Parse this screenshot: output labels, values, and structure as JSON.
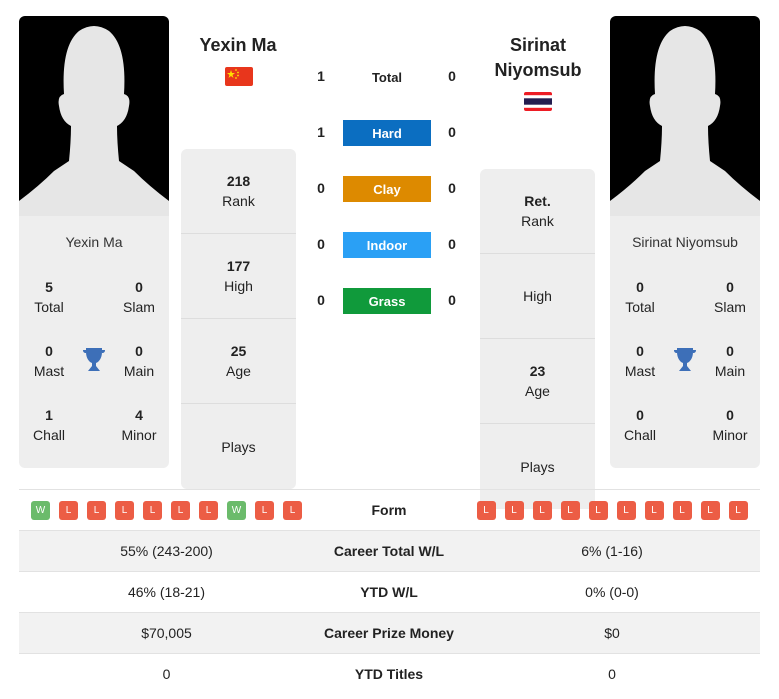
{
  "colors": {
    "hard": "#0b6ec1",
    "clay": "#dd8a00",
    "indoor": "#2aa0f5",
    "grass": "#109a3b",
    "win": "#6bbb6b",
    "loss": "#ec5d45",
    "trophy": "#3d6fb8"
  },
  "player1": {
    "name": "Yexin Ma",
    "flag": "china-flag",
    "card_name": "Yexin Ma",
    "titles": {
      "total": "5",
      "total_label": "Total",
      "slam": "0",
      "slam_label": "Slam",
      "mast": "0",
      "mast_label": "Mast",
      "main": "0",
      "main_label": "Main",
      "chall": "1",
      "chall_label": "Chall",
      "minor": "4",
      "minor_label": "Minor"
    },
    "rank": "218",
    "rank_label": "Rank",
    "high": "177",
    "high_label": "High",
    "age": "25",
    "age_label": "Age",
    "plays": "",
    "plays_label": "Plays",
    "form": [
      "W",
      "L",
      "L",
      "L",
      "L",
      "L",
      "L",
      "W",
      "L",
      "L"
    ]
  },
  "player2": {
    "name": "Sirinat Niyomsub",
    "flag": "thailand-flag",
    "card_name": "Sirinat Niyomsub",
    "titles": {
      "total": "0",
      "total_label": "Total",
      "slam": "0",
      "slam_label": "Slam",
      "mast": "0",
      "mast_label": "Mast",
      "main": "0",
      "main_label": "Main",
      "chall": "0",
      "chall_label": "Chall",
      "minor": "0",
      "minor_label": "Minor"
    },
    "rank": "Ret.",
    "rank_label": "Rank",
    "high": "",
    "high_label": "High",
    "age": "23",
    "age_label": "Age",
    "plays": "",
    "plays_label": "Plays",
    "form": [
      "L",
      "L",
      "L",
      "L",
      "L",
      "L",
      "L",
      "L",
      "L",
      "L"
    ]
  },
  "h2h": [
    {
      "label": "Total",
      "p1": "1",
      "p2": "0"
    },
    {
      "label": "Hard",
      "p1": "1",
      "p2": "0"
    },
    {
      "label": "Clay",
      "p1": "0",
      "p2": "0"
    },
    {
      "label": "Indoor",
      "p1": "0",
      "p2": "0"
    },
    {
      "label": "Grass",
      "p1": "0",
      "p2": "0"
    }
  ],
  "table": {
    "form_label": "Form",
    "rows": [
      {
        "p1": "55% (243-200)",
        "label": "Career Total W/L",
        "p2": "6% (1-16)"
      },
      {
        "p1": "46% (18-21)",
        "label": "YTD W/L",
        "p2": "0% (0-0)"
      },
      {
        "p1": "$70,005",
        "label": "Career Prize Money",
        "p2": "$0"
      },
      {
        "p1": "0",
        "label": "YTD Titles",
        "p2": "0"
      }
    ]
  }
}
